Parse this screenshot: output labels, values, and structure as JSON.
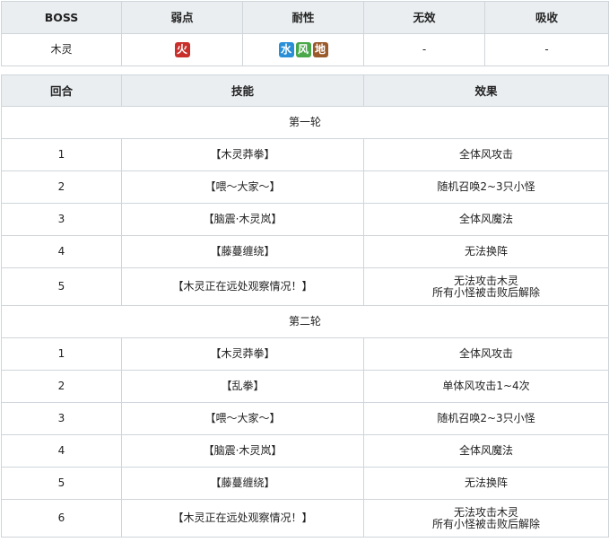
{
  "boss_table": {
    "headers": [
      "BOSS",
      "弱点",
      "耐性",
      "无效",
      "吸收"
    ],
    "row": {
      "name": "木灵",
      "weak": [
        {
          "label": "火",
          "color": "#c9302c"
        }
      ],
      "resist": [
        {
          "label": "水",
          "color": "#2a8fd6"
        },
        {
          "label": "风",
          "color": "#4aa84a"
        },
        {
          "label": "地",
          "color": "#9a5a2a"
        }
      ],
      "null": "-",
      "absorb": "-"
    }
  },
  "skill_table": {
    "headers": [
      "回合",
      "技能",
      "效果"
    ],
    "rounds": [
      {
        "title": "第一轮",
        "rows": [
          {
            "turn": "1",
            "skill": "【木灵莽拳】",
            "effect": [
              "全体风攻击"
            ]
          },
          {
            "turn": "2",
            "skill": "【喂～大家～】",
            "effect": [
              "随机召唤2~3只小怪"
            ]
          },
          {
            "turn": "3",
            "skill": "【脑震·木灵岚】",
            "effect": [
              "全体风魔法"
            ]
          },
          {
            "turn": "4",
            "skill": "【藤蔓缠绕】",
            "effect": [
              "无法换阵"
            ]
          },
          {
            "turn": "5",
            "skill": "【木灵正在远处观察情况！】",
            "effect": [
              "无法攻击木灵",
              "所有小怪被击败后解除"
            ]
          }
        ]
      },
      {
        "title": "第二轮",
        "rows": [
          {
            "turn": "1",
            "skill": "【木灵莽拳】",
            "effect": [
              "全体风攻击"
            ]
          },
          {
            "turn": "2",
            "skill": "【乱拳】",
            "effect": [
              "单体风攻击1~4次"
            ]
          },
          {
            "turn": "3",
            "skill": "【喂～大家～】",
            "effect": [
              "随机召唤2~3只小怪"
            ]
          },
          {
            "turn": "4",
            "skill": "【脑震·木灵岚】",
            "effect": [
              "全体风魔法"
            ]
          },
          {
            "turn": "5",
            "skill": "【藤蔓缠绕】",
            "effect": [
              "无法换阵"
            ]
          },
          {
            "turn": "6",
            "skill": "【木灵正在远处观察情况！】",
            "effect": [
              "无法攻击木灵",
              "所有小怪被击败后解除"
            ]
          }
        ]
      }
    ]
  }
}
